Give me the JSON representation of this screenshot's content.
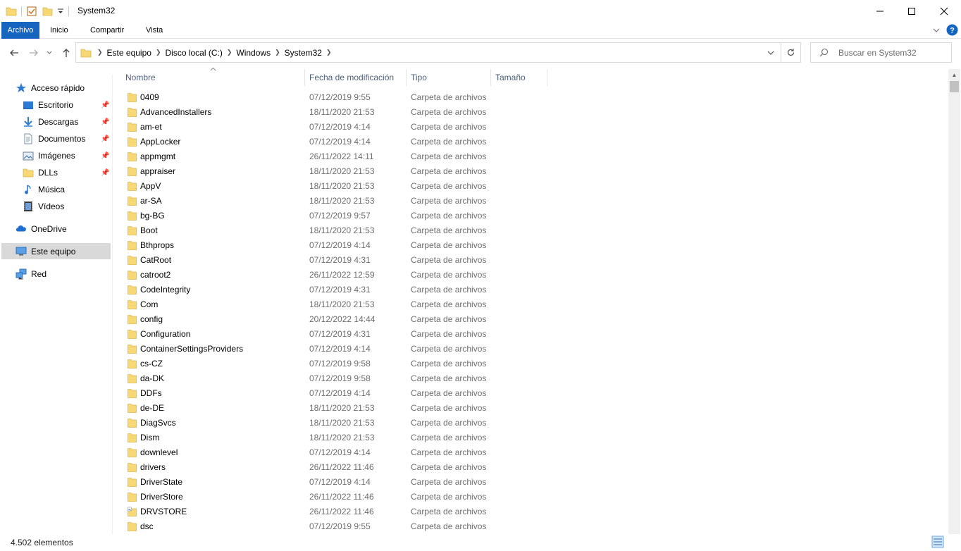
{
  "window": {
    "title": "System32"
  },
  "ribbon": {
    "tabs": [
      "Archivo",
      "Inicio",
      "Compartir",
      "Vista"
    ]
  },
  "address": {
    "crumbs": [
      "Este equipo",
      "Disco local (C:)",
      "Windows",
      "System32"
    ],
    "search_placeholder": "Buscar en System32"
  },
  "navpane": {
    "quick_access": "Acceso rápido",
    "pinned": [
      {
        "label": "Escritorio",
        "icon": "desktop-icon"
      },
      {
        "label": "Descargas",
        "icon": "download-icon"
      },
      {
        "label": "Documentos",
        "icon": "document-icon"
      },
      {
        "label": "Imágenes",
        "icon": "pictures-icon"
      },
      {
        "label": "DLLs",
        "icon": "folder-icon"
      }
    ],
    "unpinned": [
      {
        "label": "Música",
        "icon": "music-icon"
      },
      {
        "label": "Vídeos",
        "icon": "video-icon"
      }
    ],
    "onedrive": "OneDrive",
    "this_pc": "Este equipo",
    "network": "Red"
  },
  "columns": {
    "name": "Nombre",
    "date": "Fecha de modificación",
    "type": "Tipo",
    "size": "Tamaño"
  },
  "files": [
    {
      "name": "0409",
      "date": "07/12/2019 9:55",
      "type": "Carpeta de archivos"
    },
    {
      "name": "AdvancedInstallers",
      "date": "18/11/2020 21:53",
      "type": "Carpeta de archivos"
    },
    {
      "name": "am-et",
      "date": "07/12/2019 4:14",
      "type": "Carpeta de archivos"
    },
    {
      "name": "AppLocker",
      "date": "07/12/2019 4:14",
      "type": "Carpeta de archivos"
    },
    {
      "name": "appmgmt",
      "date": "26/11/2022 14:11",
      "type": "Carpeta de archivos"
    },
    {
      "name": "appraiser",
      "date": "18/11/2020 21:53",
      "type": "Carpeta de archivos"
    },
    {
      "name": "AppV",
      "date": "18/11/2020 21:53",
      "type": "Carpeta de archivos"
    },
    {
      "name": "ar-SA",
      "date": "18/11/2020 21:53",
      "type": "Carpeta de archivos"
    },
    {
      "name": "bg-BG",
      "date": "07/12/2019 9:57",
      "type": "Carpeta de archivos"
    },
    {
      "name": "Boot",
      "date": "18/11/2020 21:53",
      "type": "Carpeta de archivos"
    },
    {
      "name": "Bthprops",
      "date": "07/12/2019 4:14",
      "type": "Carpeta de archivos"
    },
    {
      "name": "CatRoot",
      "date": "07/12/2019 4:31",
      "type": "Carpeta de archivos"
    },
    {
      "name": "catroot2",
      "date": "26/11/2022 12:59",
      "type": "Carpeta de archivos"
    },
    {
      "name": "CodeIntegrity",
      "date": "07/12/2019 4:31",
      "type": "Carpeta de archivos"
    },
    {
      "name": "Com",
      "date": "18/11/2020 21:53",
      "type": "Carpeta de archivos"
    },
    {
      "name": "config",
      "date": "20/12/2022 14:44",
      "type": "Carpeta de archivos"
    },
    {
      "name": "Configuration",
      "date": "07/12/2019 4:31",
      "type": "Carpeta de archivos"
    },
    {
      "name": "ContainerSettingsProviders",
      "date": "07/12/2019 4:14",
      "type": "Carpeta de archivos"
    },
    {
      "name": "cs-CZ",
      "date": "07/12/2019 9:58",
      "type": "Carpeta de archivos"
    },
    {
      "name": "da-DK",
      "date": "07/12/2019 9:58",
      "type": "Carpeta de archivos"
    },
    {
      "name": "DDFs",
      "date": "07/12/2019 4:14",
      "type": "Carpeta de archivos"
    },
    {
      "name": "de-DE",
      "date": "18/11/2020 21:53",
      "type": "Carpeta de archivos"
    },
    {
      "name": "DiagSvcs",
      "date": "18/11/2020 21:53",
      "type": "Carpeta de archivos"
    },
    {
      "name": "Dism",
      "date": "18/11/2020 21:53",
      "type": "Carpeta de archivos"
    },
    {
      "name": "downlevel",
      "date": "07/12/2019 4:14",
      "type": "Carpeta de archivos"
    },
    {
      "name": "drivers",
      "date": "26/11/2022 11:46",
      "type": "Carpeta de archivos"
    },
    {
      "name": "DriverState",
      "date": "07/12/2019 4:14",
      "type": "Carpeta de archivos"
    },
    {
      "name": "DriverStore",
      "date": "26/11/2022 11:46",
      "type": "Carpeta de archivos"
    },
    {
      "name": "DRVSTORE",
      "date": "26/11/2022 11:46",
      "type": "Carpeta de archivos",
      "special": true
    },
    {
      "name": "dsc",
      "date": "07/12/2019 9:55",
      "type": "Carpeta de archivos"
    }
  ],
  "status": {
    "count": "4.502 elementos"
  },
  "colors": {
    "accent": "#1565c0",
    "folder": "#f8d775",
    "header_text": "#4c607a",
    "secondary_text": "#6d6d6d"
  }
}
